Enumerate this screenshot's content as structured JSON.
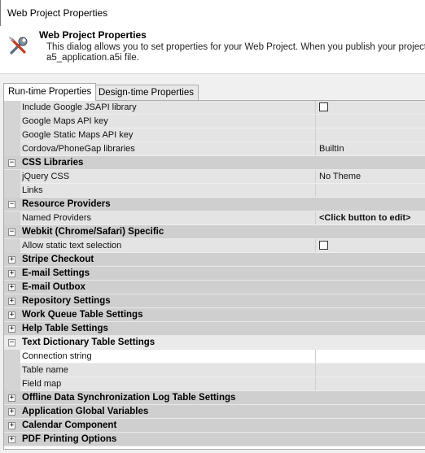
{
  "window": {
    "title": "Web Project Properties"
  },
  "header": {
    "title": "Web Project Properties",
    "description_line1": "This dialog allows you to set properties for your Web Project. When you publish your project, the",
    "description_line2": "a5_application.a5i file.",
    "icon": "tools-icon"
  },
  "tabs": [
    {
      "label": "Run-time Properties",
      "active": true
    },
    {
      "label": "Design-time Properties",
      "active": false
    }
  ],
  "grid": {
    "rows": [
      {
        "kind": "prop",
        "name": "Include Google JSAPI library",
        "value": "",
        "checkbox": true
      },
      {
        "kind": "prop",
        "name": "Google Maps API key",
        "value": ""
      },
      {
        "kind": "prop",
        "name": "Google Static Maps API key",
        "value": ""
      },
      {
        "kind": "prop",
        "name": "Cordova/PhoneGap libraries",
        "value": "BuiltIn"
      },
      {
        "kind": "cat",
        "name": "CSS Libraries",
        "expanded": true
      },
      {
        "kind": "prop",
        "name": "jQuery CSS",
        "value": "No Theme"
      },
      {
        "kind": "prop",
        "name": "Links",
        "value": ""
      },
      {
        "kind": "cat",
        "name": "Resource Providers",
        "expanded": true
      },
      {
        "kind": "prop",
        "name": "Named Providers",
        "value": "<Click button to edit>",
        "bold_value": true
      },
      {
        "kind": "cat",
        "name": "Webkit (Chrome/Safari) Specific",
        "expanded": true
      },
      {
        "kind": "prop",
        "name": "Allow static text selection",
        "value": "",
        "checkbox": true
      },
      {
        "kind": "cat",
        "name": "Stripe Checkout",
        "expanded": false
      },
      {
        "kind": "cat",
        "name": "E-mail Settings",
        "expanded": false
      },
      {
        "kind": "cat",
        "name": "E-mail Outbox",
        "expanded": false
      },
      {
        "kind": "cat",
        "name": "Repository Settings",
        "expanded": false
      },
      {
        "kind": "cat",
        "name": "Work Queue Table Settings",
        "expanded": false
      },
      {
        "kind": "cat",
        "name": "Help Table Settings",
        "expanded": false
      },
      {
        "kind": "cat",
        "name": "Text Dictionary Table Settings",
        "expanded": true,
        "selected": true
      },
      {
        "kind": "prop",
        "name": "Connection string",
        "value": "",
        "white": true
      },
      {
        "kind": "prop",
        "name": "Table name",
        "value": ""
      },
      {
        "kind": "prop",
        "name": "Field map",
        "value": ""
      },
      {
        "kind": "cat",
        "name": "Offline Data Synchronization Log Table Settings",
        "expanded": false
      },
      {
        "kind": "cat",
        "name": "Application Global Variables",
        "expanded": false
      },
      {
        "kind": "cat",
        "name": "Calendar Component",
        "expanded": false
      },
      {
        "kind": "cat",
        "name": "PDF Printing Options",
        "expanded": false
      }
    ]
  },
  "colors": {
    "category_bg": "#cfcfcf",
    "property_bg": "#e4e4e4",
    "gutter_bg": "#d4d4d4",
    "selected_category_bg": "#eaeaea"
  }
}
